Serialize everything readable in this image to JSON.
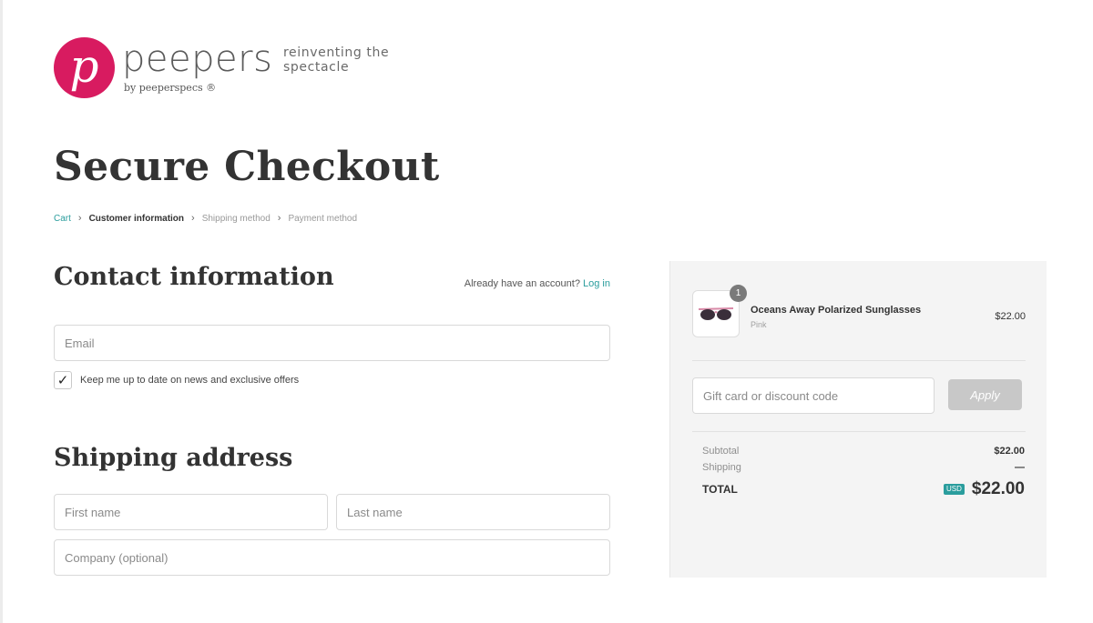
{
  "brand": {
    "logo_letter": "p",
    "name": "peepers",
    "tagline": "reinventing the spectacle",
    "byline": "by peeperspecs ®",
    "accent_color": "#d81b60",
    "link_color": "#2a9d9d"
  },
  "page": {
    "title": "Secure Checkout"
  },
  "breadcrumb": [
    {
      "label": "Cart",
      "state": "link"
    },
    {
      "label": "Customer information",
      "state": "current"
    },
    {
      "label": "Shipping method",
      "state": "upcoming"
    },
    {
      "label": "Payment method",
      "state": "upcoming"
    }
  ],
  "contact": {
    "title": "Contact information",
    "login_prompt": "Already have an account?",
    "login_link": "Log in",
    "email_placeholder": "Email",
    "newsletter_checked": true,
    "newsletter_label": "Keep me up to date on news and exclusive offers"
  },
  "shipping": {
    "title": "Shipping address",
    "first_name_placeholder": "First name",
    "last_name_placeholder": "Last name",
    "company_placeholder": "Company (optional)"
  },
  "order_summary": {
    "item": {
      "quantity": "1",
      "name": "Oceans Away Polarized Sunglasses",
      "variant": "Pink",
      "price": "$22.00",
      "thumbnail_icon": "sunglasses-icon"
    },
    "discount_placeholder": "Gift card or discount code",
    "apply_label": "Apply",
    "subtotal_label": "Subtotal",
    "subtotal_value": "$22.00",
    "shipping_label": "Shipping",
    "shipping_value": "—",
    "total_label": "TOTAL",
    "currency": "USD",
    "total_value": "$22.00"
  }
}
